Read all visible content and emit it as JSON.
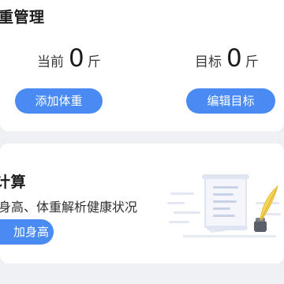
{
  "weight_card": {
    "title": "重管理",
    "current_label": "当前",
    "current_value": "0",
    "current_unit": "斤",
    "target_label": "目标",
    "target_value": "0",
    "target_unit": "斤",
    "add_weight_label": "添加体重",
    "edit_target_label": "编辑目标"
  },
  "bmi_card": {
    "title": "计算",
    "description": "身高、体重解析健康状况",
    "add_height_label": "加身高",
    "illustration_icon": "document-with-quill-icon"
  },
  "colors": {
    "accent": "#4a8bf3",
    "background": "#eef0f3",
    "card": "#ffffff",
    "illustration_light": "#dde4f2",
    "illustration_mid": "#b9c6e0"
  }
}
